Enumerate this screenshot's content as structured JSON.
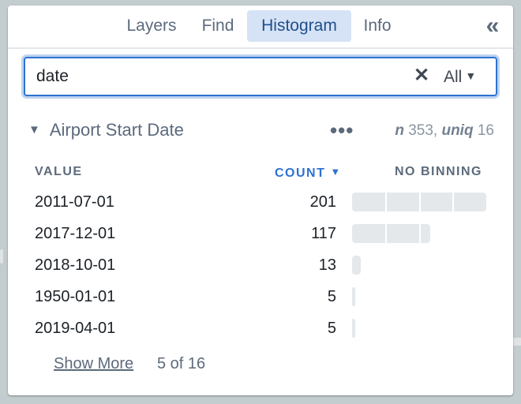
{
  "tabs": [
    {
      "label": "Layers",
      "active": false
    },
    {
      "label": "Find",
      "active": false
    },
    {
      "label": "Histogram",
      "active": true
    },
    {
      "label": "Info",
      "active": false
    }
  ],
  "collapse_icon": "double-chevron-left-icon",
  "collapse_glyph": "«",
  "search": {
    "value": "date",
    "placeholder": "",
    "clear_glyph": "✕",
    "scope_value": "All",
    "scope_caret": "▼"
  },
  "section": {
    "caret": "▼",
    "title": "Airport Start Date",
    "more_glyph": "•••",
    "n_label": "n",
    "n_value": "353",
    "uniq_label": "uniq",
    "uniq_value": "16"
  },
  "columns": {
    "value": "VALUE",
    "count": "COUNT",
    "count_sort_icon": "▼",
    "binning": "NO BINNING"
  },
  "rows": [
    {
      "value": "2011-07-01",
      "count": 201
    },
    {
      "value": "2017-12-01",
      "count": 117
    },
    {
      "value": "2018-10-01",
      "count": 13
    },
    {
      "value": "1950-01-01",
      "count": 5
    },
    {
      "value": "2019-04-01",
      "count": 5
    }
  ],
  "bar_scale_max": 201,
  "bar_grid_step": 50,
  "footer": {
    "show_more": "Show More",
    "page_info": "5 of 16"
  }
}
